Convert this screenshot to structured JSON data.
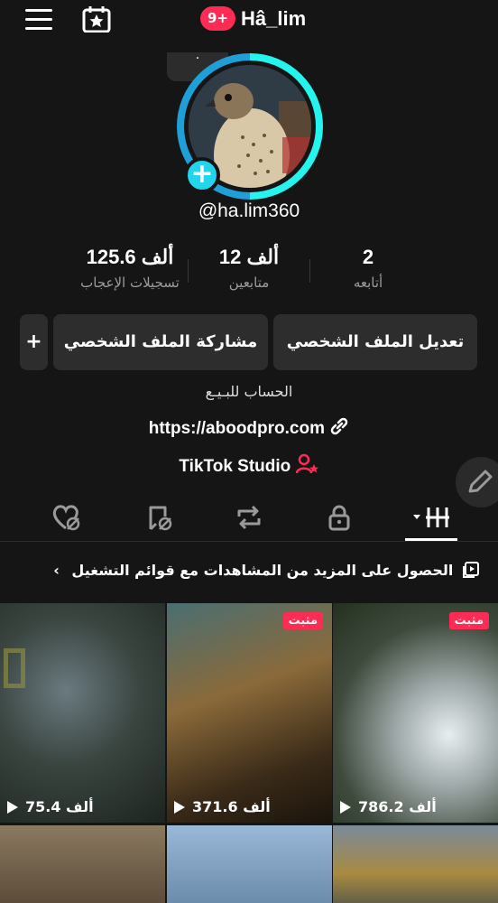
{
  "header": {
    "notifications": "9+",
    "title": "Hâ_lim"
  },
  "profile": {
    "story_dot": "·",
    "handle": "@ha.lim360",
    "add_symbol": "+"
  },
  "stats": [
    {
      "value": "2",
      "label": "أتابعه"
    },
    {
      "value": "12 ألف",
      "label": "متابعين"
    },
    {
      "value": "125.6 ألف",
      "label": "تسجيلات الإعجاب"
    }
  ],
  "buttons": {
    "edit_profile": "تعديل الملف الشخصي",
    "share_profile": "مشاركة الملف الشخصي",
    "add_friend": "+"
  },
  "bio": "الحساب للبـيـع",
  "link": "https://aboodpro.com",
  "studio": "TikTok Studio",
  "playlist_prompt": "الحصول على المزيد من المشاهدات مع قوائم التشغيل",
  "playlist_chevron": "‹",
  "videos": [
    {
      "views": "75.4 ألف",
      "pinned": ""
    },
    {
      "views": "371.6 ألف",
      "pinned": "مثبت"
    },
    {
      "views": "786.2 ألف",
      "pinned": "مثبت"
    }
  ],
  "colors": {
    "accent": "#fe2c55",
    "ring": "#25f4ee",
    "background": "#151515"
  }
}
